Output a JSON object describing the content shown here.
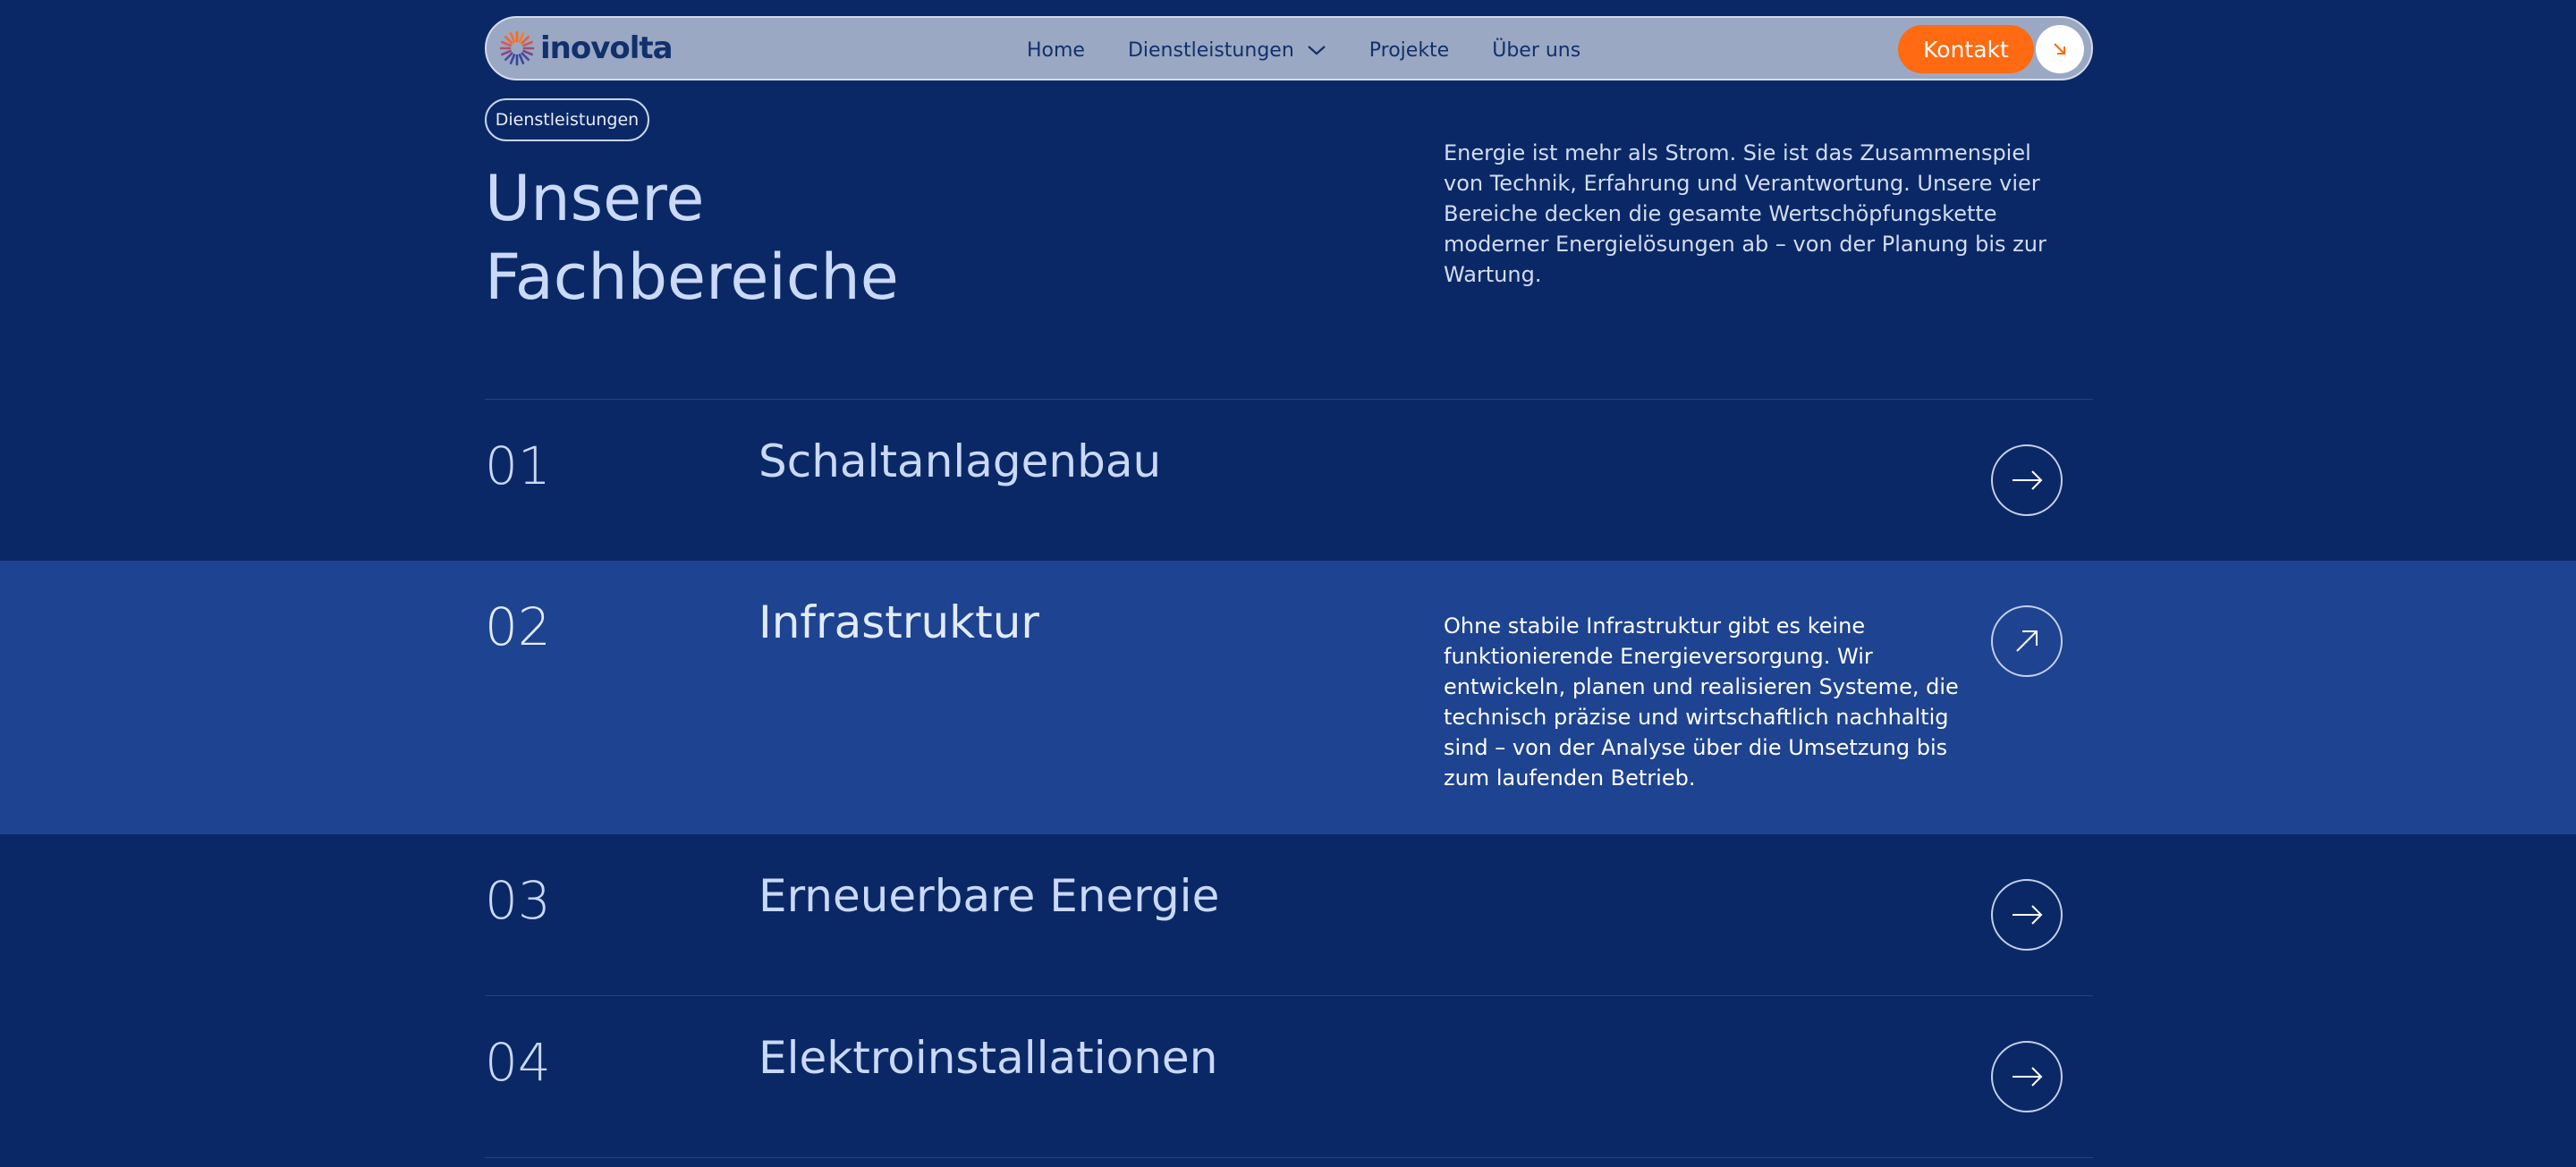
{
  "brand": {
    "name": "inovolta",
    "accent": "#ff6a12",
    "background": "#0b2866"
  },
  "nav": {
    "links": [
      {
        "label": "Home"
      },
      {
        "label": "Dienstleistungen"
      },
      {
        "label": "Projekte"
      },
      {
        "label": "Über uns"
      }
    ],
    "cta_label": "Kontakt",
    "cta_icon": "arrow-down-right-icon",
    "dropdown_icon": "chevron-down-icon"
  },
  "section": {
    "tag": "Dienstleistungen",
    "title_line1": "Unsere",
    "title_line2": "Fachbereiche",
    "intro": "Energie ist mehr als Strom. Sie ist das Zusammenspiel von Technik, Erfahrung und Verantwortung. Unsere vier Bereiche decken die gesamte Wertschöpfungskette moderner Energielösungen ab – von der Planung bis zur Wartung."
  },
  "services": [
    {
      "number": "01",
      "title": "Schaltanlagenbau",
      "description": "",
      "icon": "arrow-right-icon"
    },
    {
      "number": "02",
      "title": "Infrastruktur",
      "description": "Ohne stabile Infrastruktur gibt es keine funktionierende Energieversorgung. Wir entwickeln, planen und realisieren Systeme, die technisch präzise und wirtschaftlich nachhaltig sind – von der Analyse über die Umsetzung bis zum laufenden Betrieb.",
      "icon": "arrow-up-right-icon"
    },
    {
      "number": "03",
      "title": "Erneuerbare Energie",
      "description": "",
      "icon": "arrow-right-icon"
    },
    {
      "number": "04",
      "title": "Elektroinstallationen",
      "description": "",
      "icon": "arrow-right-icon"
    }
  ]
}
